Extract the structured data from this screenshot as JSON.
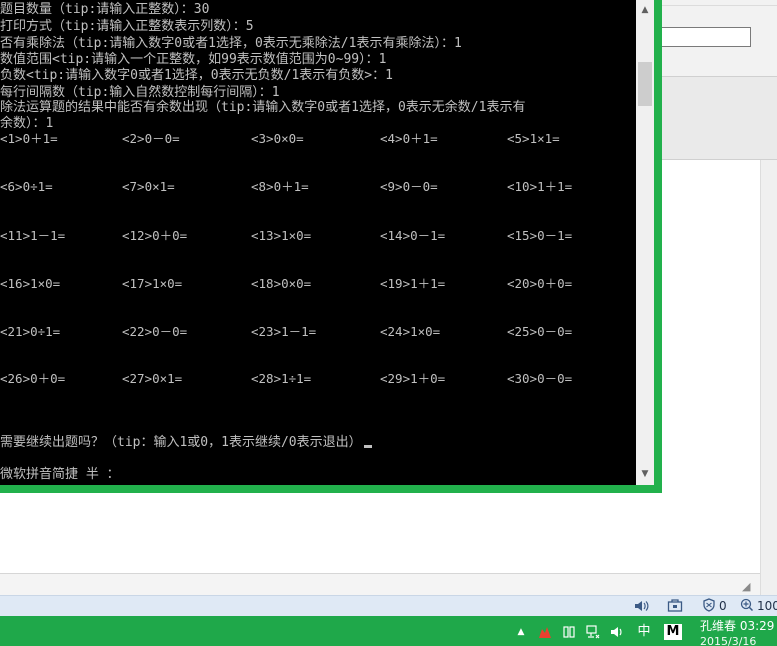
{
  "console": {
    "lines": [
      "题目数量（tip:请输入正整数）：30",
      "打印方式（tip:请输入正整数表示列数）：5",
      "否有乘除法（tip:请输入数字0或者1选择，0表示无乘除法/1表示有乘除法）：1",
      "数值范围<tip:请输入一个正整数，如99表示数值范围为0~99）：1",
      "负数<tip:请输入数字0或者1选择，0表示无负数/1表示有负数>：1",
      "每行间隔数（tip:输入自然数控制每行间隔）：1",
      "除法运算题的结果中能否有余数出现（tip:请输入数字0或者1选择，0表示无余数/1表示有",
      "余数）：1"
    ],
    "problems": [
      [
        "<1>0＋1=",
        "<2>0－0=",
        "<3>0×0=",
        "<4>0＋1=",
        "<5>1×1="
      ],
      [
        "<6>0÷1=",
        "<7>0×1=",
        "<8>0＋1=",
        "<9>0－0=",
        "<10>1＋1="
      ],
      [
        "<11>1－1=",
        "<12>0＋0=",
        "<13>1×0=",
        "<14>0－1=",
        "<15>0－1="
      ],
      [
        "<16>1×0=",
        "<17>1×0=",
        "<18>0×0=",
        "<19>1＋1=",
        "<20>0＋0="
      ],
      [
        "<21>0÷1=",
        "<22>0－0=",
        "<23>1－1=",
        "<24>1×0=",
        "<25>0－0="
      ],
      [
        "<26>0＋0=",
        "<27>0×1=",
        "<28>1÷1=",
        "<29>1＋0=",
        "<30>0－0="
      ]
    ],
    "continue_prompt": "需要继续出题吗？（tip：输入1或0，1表示继续/0表示退出）",
    "ime_status": "微软拼音简捷 半 ："
  },
  "statusbar": {
    "sound_icon": "speaker-icon",
    "security_icon": "shield-icon",
    "blocked_count": "0",
    "zoom_label": "100"
  },
  "taskbar": {
    "ime_lang": "中",
    "ime_mode": "M",
    "clock_line1": "孔维春 03:29",
    "clock_line2": "2015/3/16"
  },
  "colors": {
    "console_bg": "#000000",
    "console_text": "#c0c0c0",
    "frame_accent": "#22b14c",
    "taskbar": "#1fa84a"
  }
}
